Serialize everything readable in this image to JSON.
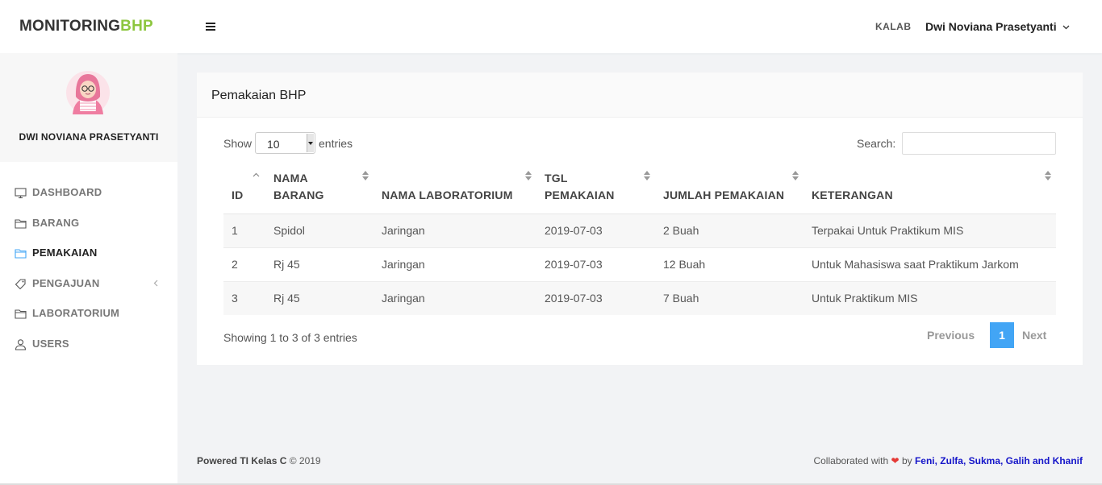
{
  "header": {
    "brand_main": "MONITORING",
    "brand_accent": "BHP",
    "role": "KALAB",
    "user_name": "Dwi Noviana Prasetyanti"
  },
  "sidebar": {
    "profile_name": "DWI NOVIANA PRASETYANTI",
    "items": [
      {
        "label": "DASHBOARD",
        "icon": "monitor-icon",
        "active": false
      },
      {
        "label": "BARANG",
        "icon": "folder-icon",
        "active": false
      },
      {
        "label": "PEMAKAIAN",
        "icon": "folder-icon",
        "active": true
      },
      {
        "label": "PENGAJUAN",
        "icon": "tag-icon",
        "active": false,
        "has_submenu": true
      },
      {
        "label": "LABORATORIUM",
        "icon": "folder-icon",
        "active": false
      },
      {
        "label": "USERS",
        "icon": "user-icon",
        "active": false
      }
    ]
  },
  "card": {
    "title": "Pemakaian BHP",
    "length_prefix": "Show",
    "length_value": "10",
    "length_suffix": "entries",
    "search_label": "Search:",
    "search_value": ""
  },
  "table": {
    "headers": [
      "ID",
      "NAMA BARANG",
      "NAMA LABORATORIUM",
      "TGL PEMAKAIAN",
      "JUMLAH PEMAKAIAN",
      "KETERANGAN"
    ],
    "rows": [
      [
        "1",
        "Spidol",
        "Jaringan",
        "2019-07-03",
        "2 Buah",
        "Terpakai Untuk Praktikum MIS"
      ],
      [
        "2",
        "Rj 45",
        "Jaringan",
        "2019-07-03",
        "12 Buah",
        "Untuk Mahasiswa saat Praktikum Jarkom"
      ],
      [
        "3",
        "Rj 45",
        "Jaringan",
        "2019-07-03",
        "7 Buah",
        "Untuk Praktikum MIS"
      ]
    ]
  },
  "pagination": {
    "info": "Showing 1 to 3 of 3 entries",
    "previous": "Previous",
    "current_page": "1",
    "next": "Next"
  },
  "footer": {
    "powered_bold": "Powered TI Kelas C",
    "powered_rest": "© 2019",
    "collab_prefix": "Collaborated with",
    "collab_by": "by",
    "collab_names": "Feni, Zulfa, Sukma, Galih and Khanif"
  },
  "colors": {
    "brand_accent": "#8dc63f",
    "pager_active": "#42a5f5",
    "heart": "#e53935",
    "footer_link": "#1515c9"
  }
}
